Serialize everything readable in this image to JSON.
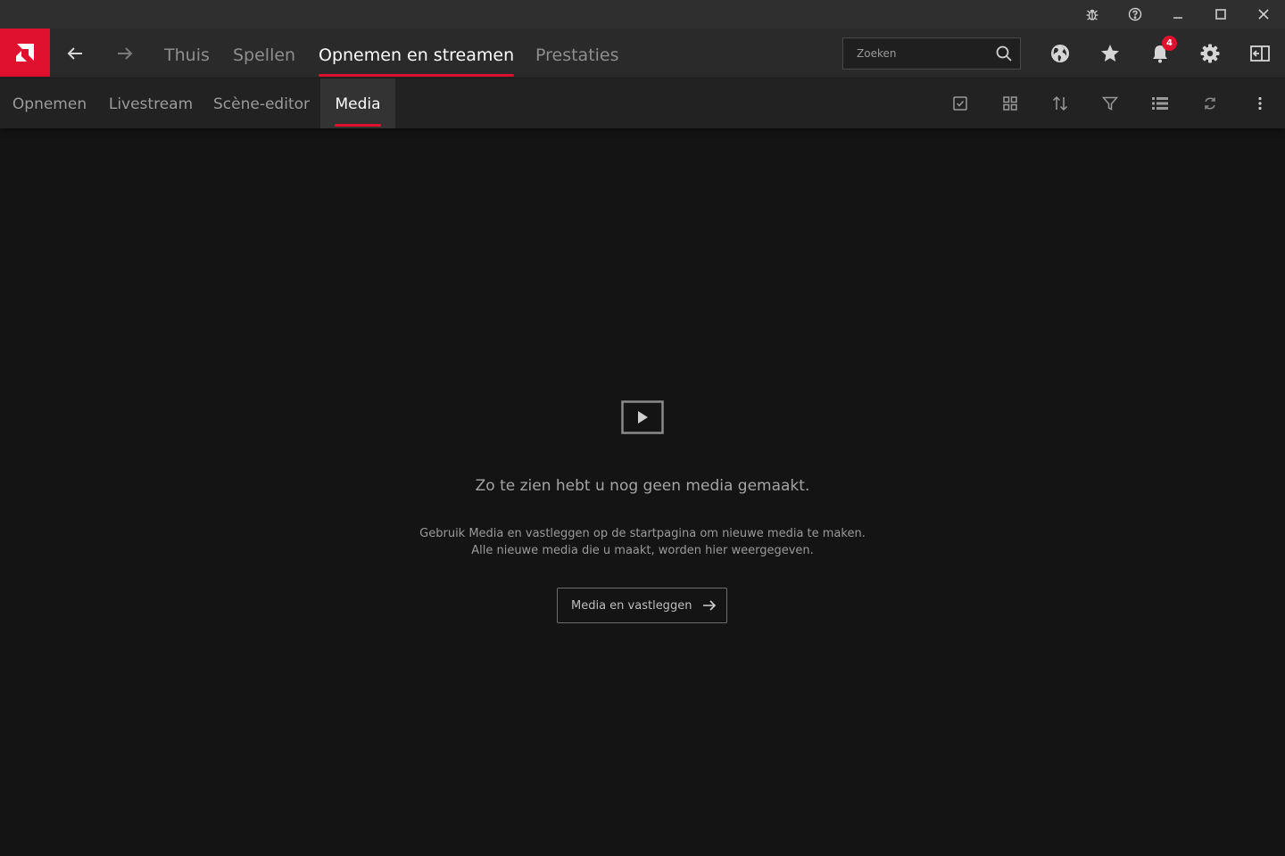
{
  "nav": {
    "tabs": [
      "Thuis",
      "Spellen",
      "Opnemen en streamen",
      "Prestaties"
    ],
    "search_placeholder": "Zoeken",
    "notification_count": "4"
  },
  "subnav": {
    "tabs": [
      "Opnemen",
      "Livestream",
      "Scène-editor",
      "Media"
    ]
  },
  "empty_state": {
    "title": "Zo te zien hebt u nog geen media gemaakt.",
    "line1": "Gebruik Media en vastleggen op de startpagina om nieuwe media te maken.",
    "line2": "Alle nieuwe media die u maakt, worden hier weergegeven.",
    "button_label": "Media en vastleggen"
  },
  "colors": {
    "accent": "#e0102f",
    "background": "#141414",
    "titlebar": "#2f2f2f",
    "navbar": "#2a2a2a",
    "subnav": "#222222"
  }
}
